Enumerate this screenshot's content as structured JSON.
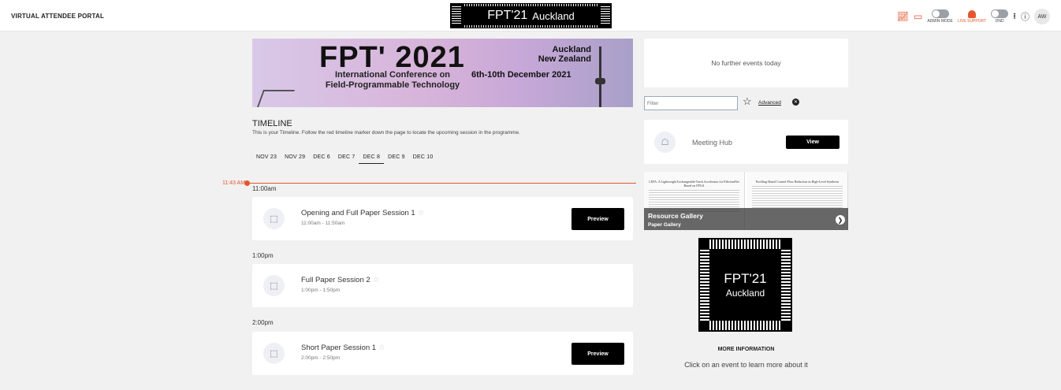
{
  "header": {
    "portal_title": "VIRTUAL ATTENDEE PORTAL",
    "logo": {
      "title": "FPT'21",
      "city": "Auckland"
    },
    "admin_mode_label": "ADMIN MODE",
    "live_support_label": "LIVE SUPPORT",
    "dnd_label": "DND",
    "avatar_initials": "AW",
    "accent_color": "#e4572e"
  },
  "banner": {
    "title": "FPT' 2021",
    "subtitle_line1": "International Conference on",
    "subtitle_line2": "Field-Programmable Technology",
    "city": "Auckland",
    "country": "New Zealand",
    "dates": "6th-10th December 2021"
  },
  "timeline": {
    "title": "TIMELINE",
    "description": "This is your Timeline. Follow the red timeline marker down the page to locate the upcoming session in the programme.",
    "tabs": [
      "NOV 23",
      "NOV 29",
      "DEC 6",
      "DEC 7",
      "DEC 8",
      "DEC 9",
      "DEC 10"
    ],
    "active_tab": "DEC 8",
    "now_marker": "11:43 AM"
  },
  "sessions": [
    {
      "time_heading": "11:00am",
      "name": "Opening and Full Paper Session 1",
      "time": "11:00am - 11:50am",
      "button": "Preview"
    },
    {
      "time_heading": "1:00pm",
      "name": "Full Paper Session 2",
      "time": "1:00pm - 1:50pm",
      "button": ""
    },
    {
      "time_heading": "2:00pm",
      "name": "Short Paper Session 1",
      "time": "2:00pm - 2:50pm",
      "button": "Preview"
    }
  ],
  "sidebar": {
    "no_events": "No further events today",
    "filter_placeholder": "Filter",
    "advanced": "Advanced",
    "meeting_hub": {
      "label": "Meeting Hub",
      "button": "View"
    },
    "gallery": {
      "title": "Resource Gallery",
      "subtitle": "Paper Gallery",
      "paper1_title": "LEFA: A Lightweight Exchangeable-Track Accelerator for EfficientNet Based on FPGA",
      "paper2_title": "Profiling-Based Control-Flow Reduction in High-Level Synthesis"
    },
    "chip": {
      "title": "FPT'21",
      "city": "Auckland"
    },
    "more_info_heading": "MORE INFORMATION",
    "more_info_text": "Click on an event to learn more about it"
  }
}
